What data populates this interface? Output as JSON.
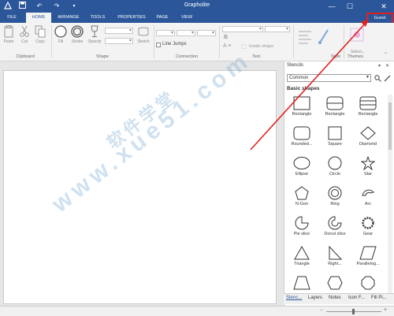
{
  "app": {
    "title": "Grapholite"
  },
  "tabs": [
    {
      "label": "FILE"
    },
    {
      "label": "HOME"
    },
    {
      "label": "ARRANGE"
    },
    {
      "label": "TOOLS"
    },
    {
      "label": "PROPERTIES"
    },
    {
      "label": "PAGE"
    },
    {
      "label": "VIEW"
    }
  ],
  "active_tab": "HOME",
  "account": {
    "label": "Guest"
  },
  "ribbon": {
    "clipboard": {
      "label": "Clipboard",
      "paste": "Paste",
      "cut": "Cut",
      "copy": "Copy"
    },
    "shape": {
      "label": "Shape",
      "fill": "Fill",
      "stroke": "Stroke",
      "opacity": "Opacity",
      "sketch": "Sketch"
    },
    "connection": {
      "label": "Connection",
      "line_jumps": "Line Jumps"
    },
    "text": {
      "label": "Text",
      "inside_shape": "Inside shape"
    },
    "style": {
      "label": "Style"
    },
    "themes": {
      "label": "Themes",
      "select": "Select..."
    }
  },
  "stencils": {
    "title": "Stencils",
    "library": "Common",
    "category": "Basic shapes",
    "shapes": [
      {
        "label": "Rectangle",
        "icon": "rectangle-icon"
      },
      {
        "label": "Rectangle",
        "icon": "rounded-rectangle-icon"
      },
      {
        "label": "Rectangle",
        "icon": "table-rectangle-icon"
      },
      {
        "label": "Rounded...",
        "icon": "rounded-square-icon"
      },
      {
        "label": "Square",
        "icon": "square-icon"
      },
      {
        "label": "Diamond",
        "icon": "diamond-icon"
      },
      {
        "label": "Ellipse",
        "icon": "ellipse-icon"
      },
      {
        "label": "Circle",
        "icon": "circle-icon"
      },
      {
        "label": "Star",
        "icon": "star-icon"
      },
      {
        "label": "N-Gon",
        "icon": "pentagon-icon"
      },
      {
        "label": "Ring",
        "icon": "ring-icon"
      },
      {
        "label": "Arc",
        "icon": "arc-icon"
      },
      {
        "label": "Pie slice",
        "icon": "pie-slice-icon"
      },
      {
        "label": "Donut slice",
        "icon": "donut-slice-icon"
      },
      {
        "label": "Gear",
        "icon": "gear-icon"
      },
      {
        "label": "Triangle",
        "icon": "triangle-icon"
      },
      {
        "label": "Right...",
        "icon": "right-triangle-icon"
      },
      {
        "label": "Parallelog...",
        "icon": "parallelogram-icon"
      }
    ]
  },
  "bottom_tabs": [
    {
      "label": "Stenc..."
    },
    {
      "label": "Layers"
    },
    {
      "label": "Notes"
    },
    {
      "label": "Icon F..."
    },
    {
      "label": "Fill Pi..."
    }
  ],
  "watermark": {
    "line1": "软件学堂",
    "line2": "www.xue51.com"
  },
  "colors": {
    "accent": "#2b579a",
    "highlight": "#e02020"
  }
}
